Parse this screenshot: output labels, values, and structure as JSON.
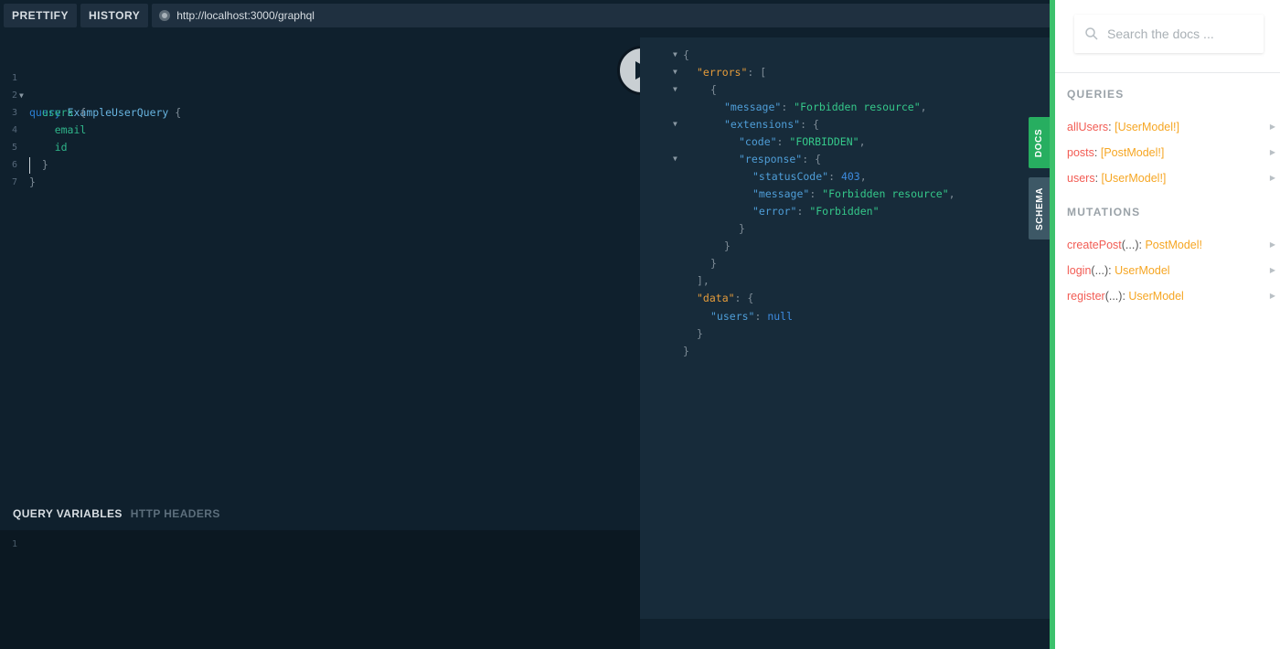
{
  "toolbar": {
    "prettify_label": "PRETTIFY",
    "history_label": "HISTORY",
    "url": "http://localhost:3000/graphql"
  },
  "editor": {
    "line_numbers": [
      "1",
      "2",
      "3",
      "4",
      "5",
      "6",
      "7"
    ],
    "tokens": {
      "query_kw": "query",
      "op_name": "ExampleUserQuery",
      "brace_open": "{",
      "users": "users",
      "email": "email",
      "id": "id",
      "brace_close": "}"
    }
  },
  "variables": {
    "active_tab": "QUERY VARIABLES",
    "other_tab": "HTTP HEADERS",
    "line_number": "1"
  },
  "result": {
    "brace_open": "{",
    "brace_close": "}",
    "bracket_open": "[",
    "bracket_close": "],",
    "errors_key": "\"errors\"",
    "message_key": "\"message\"",
    "message_val": "\"Forbidden resource\"",
    "extensions_key": "\"extensions\"",
    "code_key": "\"code\"",
    "code_val": "\"FORBIDDEN\"",
    "response_key": "\"response\"",
    "statusCode_key": "\"statusCode\"",
    "statusCode_val": "403",
    "error_key": "\"error\"",
    "error_val": "\"Forbidden\"",
    "data_key": "\"data\"",
    "users_key": "\"users\"",
    "users_val": "null"
  },
  "side_tabs": {
    "docs": "DOCS",
    "schema": "SCHEMA"
  },
  "docs": {
    "search_placeholder": "Search the docs ...",
    "queries_title": "QUERIES",
    "queries": [
      {
        "field": "allUsers",
        "args": "",
        "type": "[UserModel!]"
      },
      {
        "field": "posts",
        "args": "",
        "type": "[PostModel!]"
      },
      {
        "field": "users",
        "args": "",
        "type": "[UserModel!]"
      }
    ],
    "mutations_title": "MUTATIONS",
    "mutations": [
      {
        "field": "createPost",
        "args": "(...)",
        "type": "PostModel!"
      },
      {
        "field": "login",
        "args": "(...)",
        "type": "UserModel"
      },
      {
        "field": "register",
        "args": "(...)",
        "type": "UserModel"
      }
    ]
  },
  "colors": {
    "docs_tab": "#27ae60",
    "schema_tab": "#3d5866",
    "field": "#f25c54",
    "type": "#f6a623"
  }
}
